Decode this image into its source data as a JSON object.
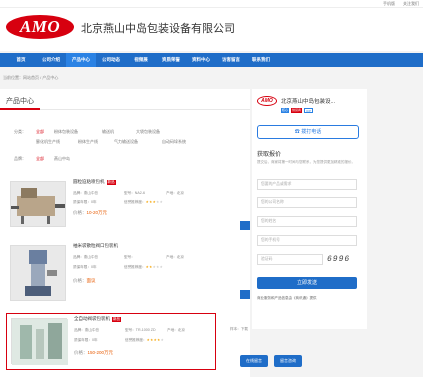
{
  "topbar": {
    "phone": "手机版",
    "follow": "关注我们"
  },
  "header": {
    "logo_text": "AMO",
    "company_name": "北京燕山中岛包装设备有限公司"
  },
  "nav": {
    "items": [
      "首页",
      "公司介绍",
      "产品中心",
      "公司动态",
      "视频展",
      "资质荣誉",
      "资料中心",
      "访客留言",
      "联系我们"
    ]
  },
  "breadcrumb": "当前位置：网站首页 / 产品中心",
  "main": {
    "title": "产品中心",
    "filters": {
      "row1_label": "分类：",
      "categories": [
        "全部",
        "粉体包装设备",
        "输送机",
        "大袋包装设备",
        "膨化机生产线",
        "粉体生产线",
        "气力输送设备",
        "自动码垛系统"
      ],
      "row2_label": "品牌：",
      "brands": [
        "全部",
        "燕山中岛"
      ]
    },
    "products": [
      {
        "name": "圆粒迫粘喷包机",
        "badge": "新品",
        "brand_label": "品牌：",
        "brand": "燕山中岛",
        "model_label": "型号：",
        "model": "NA2-6",
        "origin_label": "产地：",
        "origin": "北京",
        "warranty_label": "质保年限：",
        "warranty": "0年",
        "rating_label": "信誉推荐度：",
        "rating": 3,
        "price_label": "价格：",
        "price": "10-20万元"
      },
      {
        "name": "袖米袋散粒阀口包装机",
        "badge": "",
        "brand_label": "品牌：",
        "brand": "燕山中岛",
        "model_label": "型号：",
        "model": "",
        "origin_label": "产地：",
        "origin": "北京",
        "warranty_label": "质保年限：",
        "warranty": "0年",
        "rating_label": "信誉推荐度：",
        "rating": 2,
        "price_label": "价格：",
        "price": "面议"
      },
      {
        "name": "全自动阀袋包装机",
        "badge": "新品",
        "brand_label": "品牌：",
        "brand": "燕山中岛",
        "model_label": "型号：",
        "model": "TR-1000 ZD",
        "origin_label": "产地：",
        "origin": "北京",
        "warranty_label": "质保年限：",
        "warranty": "0年",
        "rating_label": "信誉推荐度：",
        "rating": 4,
        "price_label": "价格：",
        "price": "150-200万元",
        "extra_label": "样本：",
        "extra": "下载"
      }
    ],
    "btn_online": "在线留言",
    "btn_consult": "留言咨询"
  },
  "side": {
    "logo_text": "AMO",
    "name": "北京燕山中岛包装设...",
    "tags": [
      "核心",
      "供货商",
      "ICP"
    ],
    "call_label": "拨打电话",
    "quote_title": "获取报价",
    "quote_desc": "提交后，商家将第一时间与您联系，为您提供更加精准的报价。",
    "fields": [
      "您要的产品或需求",
      "您的公司名称",
      "您的姓名",
      "您的手机号",
      "验证码"
    ],
    "captcha": "6996",
    "submit": "立即发送",
    "note": "商业服务和产品信息由《商讯通》提供"
  },
  "colors": {
    "brand_red": "#d7000f",
    "nav_blue": "#1f6dc8",
    "price_orange": "#e85a00",
    "star": "#f5a300"
  }
}
